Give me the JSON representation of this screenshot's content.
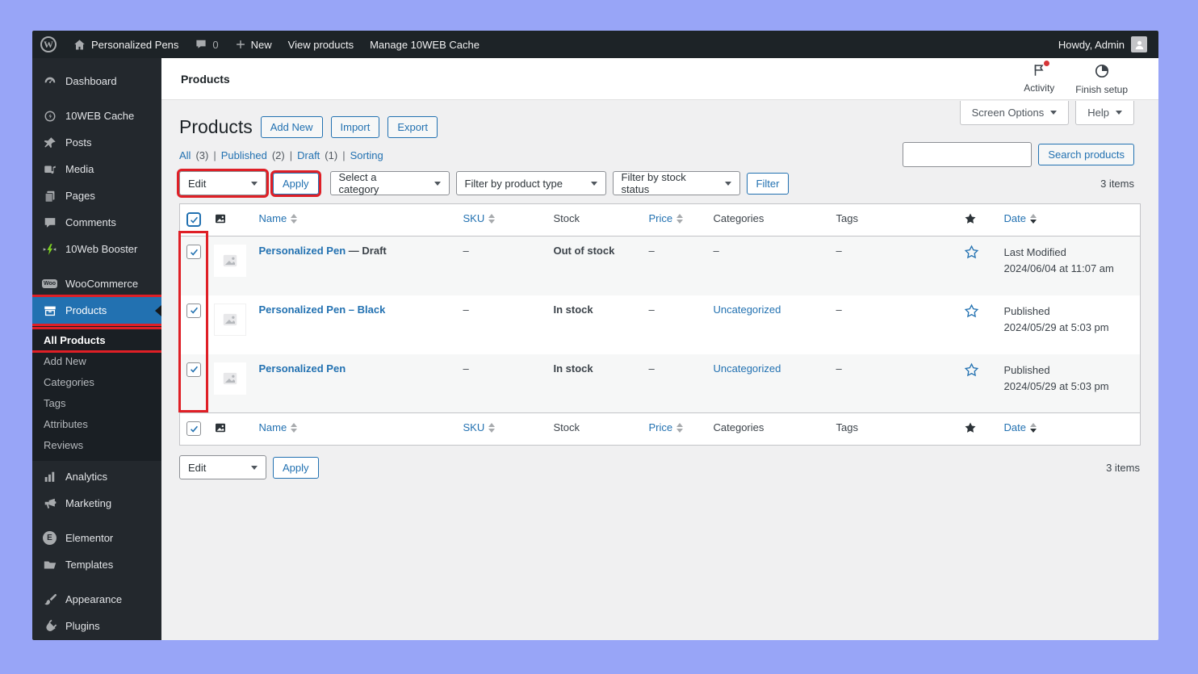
{
  "window": {
    "frame_color": "#98a5f7"
  },
  "admin_bar": {
    "wp_logo_letter": "W",
    "site_name": "Personalized Pens",
    "comment_count": "0",
    "new_button": "New",
    "view_products": "View products",
    "manage_cache": "Manage 10WEB Cache",
    "greeting": "Howdy, Admin"
  },
  "sidebar": {
    "items": [
      {
        "label": "Dashboard"
      },
      {
        "label": "10WEB Cache"
      },
      {
        "label": "Posts"
      },
      {
        "label": "Media"
      },
      {
        "label": "Pages"
      },
      {
        "label": "Comments"
      },
      {
        "label": "10Web Booster"
      },
      {
        "label": "WooCommerce",
        "badge": "Woo"
      },
      {
        "label": "Products",
        "selected": true
      },
      {
        "label": "Analytics"
      },
      {
        "label": "Marketing"
      },
      {
        "label": "Elementor",
        "badge": "E"
      },
      {
        "label": "Templates"
      },
      {
        "label": "Appearance"
      },
      {
        "label": "Plugins"
      }
    ],
    "submenu": [
      {
        "label": "All Products",
        "current": true
      },
      {
        "label": "Add New"
      },
      {
        "label": "Categories"
      },
      {
        "label": "Tags"
      },
      {
        "label": "Attributes"
      },
      {
        "label": "Reviews"
      }
    ]
  },
  "header": {
    "title": "Products",
    "activity": "Activity",
    "finish_setup": "Finish setup"
  },
  "screen_tabs": {
    "screen_options": "Screen Options",
    "help": "Help"
  },
  "page": {
    "title": "Products",
    "add_new": "Add New",
    "import": "Import",
    "export": "Export",
    "views": [
      {
        "label": "All",
        "count": "(3)"
      },
      {
        "label": "Published",
        "count": "(2)"
      },
      {
        "label": "Draft",
        "count": "(1)"
      },
      {
        "label": "Sorting",
        "count": ""
      }
    ],
    "search_value": "",
    "search_button": "Search products",
    "items_count_top": "3 items",
    "items_count_bottom": "3 items"
  },
  "bulk_actions": {
    "top_action": "Edit",
    "top_apply": "Apply",
    "bottom_action": "Edit",
    "bottom_apply": "Apply"
  },
  "filters": {
    "category": "Select a category",
    "product_type": "Filter by product type",
    "stock_status": "Filter by stock status",
    "filter_button": "Filter"
  },
  "table": {
    "columns": {
      "name": "Name",
      "sku": "SKU",
      "stock": "Stock",
      "price": "Price",
      "categories": "Categories",
      "tags": "Tags",
      "date": "Date"
    },
    "rows": [
      {
        "checked": true,
        "name": "Personalized Pen",
        "state": "— Draft",
        "sku": "–",
        "stock": "Out of stock",
        "stock_status": "out-of-stock",
        "price": "–",
        "categories": "–",
        "tags": "–",
        "date_status": "Last Modified",
        "date_value": "2024/06/04 at 11:07 am"
      },
      {
        "checked": true,
        "name": "Personalized Pen – Black",
        "sku": "–",
        "stock": "In stock",
        "stock_status": "in-stock",
        "price": "–",
        "categories": "Uncategorized",
        "tags": "–",
        "date_status": "Published",
        "date_value": "2024/05/29 at 5:03 pm"
      },
      {
        "checked": true,
        "name": "Personalized Pen",
        "sku": "–",
        "stock": "In stock",
        "stock_status": "in-stock",
        "price": "–",
        "categories": "Uncategorized",
        "tags": "–",
        "date_status": "Published",
        "date_value": "2024/05/29 at 5:03 pm"
      }
    ]
  },
  "colors": {
    "annotation_red": "#df1f26",
    "in_stock_green": "#41a62a",
    "out_of_stock_red": "#a00000",
    "link_blue": "#2271b1",
    "selected_menu_blue": "#2271b1",
    "admin_dark": "#23282d"
  }
}
